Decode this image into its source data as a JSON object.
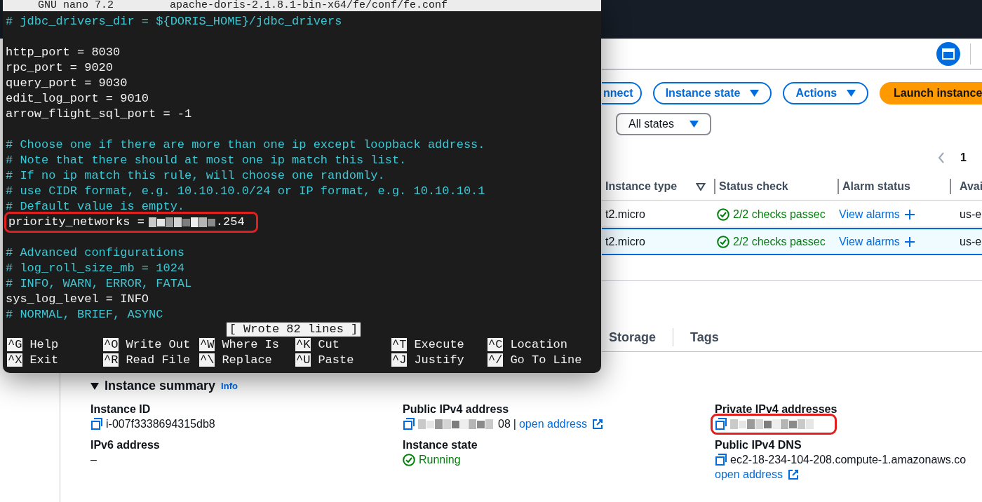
{
  "terminal": {
    "app": "GNU nano 7.2",
    "file": "apache-doris-2.1.8.1-bin-x64/fe/conf/fe.conf",
    "lines": [
      {
        "kind": "comment",
        "text": "# jdbc_drivers_dir = ${DORIS_HOME}/jdbc_drivers"
      },
      {
        "kind": "blank"
      },
      {
        "kind": "setting",
        "text": "http_port = 8030"
      },
      {
        "kind": "setting",
        "text": "rpc_port = 9020"
      },
      {
        "kind": "setting",
        "text": "query_port = 9030"
      },
      {
        "kind": "setting",
        "text": "edit_log_port = 9010"
      },
      {
        "kind": "setting",
        "text": "arrow_flight_sql_port = -1"
      },
      {
        "kind": "blank"
      },
      {
        "kind": "comment",
        "text": "# Choose one if there are more than one ip except loopback address."
      },
      {
        "kind": "comment",
        "text": "# Note that there should at most one ip match this list."
      },
      {
        "kind": "comment",
        "text": "# If no ip match this rule, will choose one randomly."
      },
      {
        "kind": "comment",
        "text": "# use CIDR format, e.g. 10.10.10.0/24 or IP format, e.g. 10.10.10.1"
      },
      {
        "kind": "comment",
        "text": "# Default value is empty."
      },
      {
        "kind": "redacted",
        "text": "priority_networks =",
        "suffix": ".254",
        "highlighted": true
      },
      {
        "kind": "blank"
      },
      {
        "kind": "comment",
        "text": "# Advanced configurations"
      },
      {
        "kind": "comment",
        "text": "# log_roll_size_mb = 1024"
      },
      {
        "kind": "comment",
        "text": "# INFO, WARN, ERROR, FATAL"
      },
      {
        "kind": "setting",
        "text": "sys_log_level = INFO"
      },
      {
        "kind": "comment",
        "text": "# NORMAL, BRIEF, ASYNC"
      }
    ],
    "status": "[ Wrote 82 lines ]",
    "shortcut_rows": [
      [
        {
          "key": "^G",
          "label": "Help"
        },
        {
          "key": "^O",
          "label": "Write Out"
        },
        {
          "key": "^W",
          "label": "Where Is"
        },
        {
          "key": "^K",
          "label": "Cut"
        },
        {
          "key": "^T",
          "label": "Execute"
        },
        {
          "key": "^C",
          "label": "Location"
        }
      ],
      [
        {
          "key": "^X",
          "label": "Exit"
        },
        {
          "key": "^R",
          "label": "Read File"
        },
        {
          "key": "^\\",
          "label": "Replace"
        },
        {
          "key": "^U",
          "label": "Paste"
        },
        {
          "key": "^J",
          "label": "Justify"
        },
        {
          "key": "^/",
          "label": "Go To Line"
        }
      ]
    ]
  },
  "console": {
    "toolbar_buttons": [
      {
        "kind": "outline",
        "label": "nnect"
      },
      {
        "kind": "dropdown",
        "label": "Instance state"
      },
      {
        "kind": "dropdown",
        "label": "Actions"
      },
      {
        "kind": "primary",
        "label": "Launch instance"
      }
    ],
    "state_filter": "All states",
    "page": "1",
    "columns": [
      "Instance type",
      "Status check",
      "Alarm status",
      "Avai"
    ],
    "rows": [
      {
        "instance_type": "t2.micro",
        "status": "2/2 checks passec",
        "alarms": "View alarms",
        "zone": "us-e",
        "selected": false
      },
      {
        "instance_type": "t2.micro",
        "status": "2/2 checks passec",
        "alarms": "View alarms",
        "zone": "us-e",
        "selected": true
      }
    ],
    "detail_tabs": [
      "Storage",
      "Tags"
    ],
    "summary": {
      "title": "Instance summary",
      "info": "Info",
      "fields": [
        {
          "kind": "copy",
          "label": "Instance ID",
          "value": "i-007f3338694315db8"
        },
        {
          "kind": "redacted",
          "label": "Public IPv4 address",
          "value": "08",
          "separator": "|",
          "link": "open address"
        },
        {
          "kind": "redacted",
          "label": "Private IPv4 addresses",
          "highlighted": true
        },
        {
          "kind": "plain",
          "label": "IPv6 address",
          "value": "–"
        },
        {
          "kind": "status",
          "label": "Instance state",
          "value": "Running"
        },
        {
          "kind": "copy",
          "label": "Public IPv4 DNS",
          "value": "ec2-18-234-104-208.compute-1.amazonaws.co",
          "link": "open address"
        }
      ]
    }
  }
}
